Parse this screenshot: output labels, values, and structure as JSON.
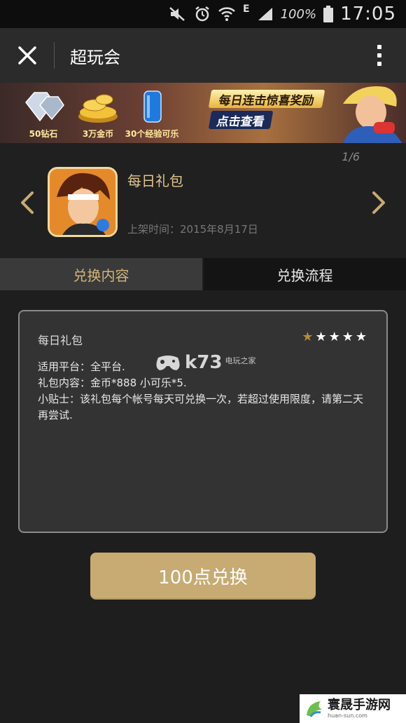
{
  "status_bar": {
    "network_type": "E",
    "battery_percent": "100%",
    "time": "17:05"
  },
  "titlebar": {
    "title": "超玩会"
  },
  "banner": {
    "prizes": [
      {
        "label": "50钻石",
        "icon": "diamond-icon"
      },
      {
        "label": "3万金币",
        "icon": "gold-coin-icon"
      },
      {
        "label": "30个经验可乐",
        "icon": "cola-can-icon"
      }
    ],
    "headline": "每日连击惊喜奖励",
    "cta": "点击查看"
  },
  "game_card": {
    "pager": "1/6",
    "name": "每日礼包",
    "release_label": "上架时间：2015年8月17日"
  },
  "tabs": [
    {
      "label": "兑换内容",
      "active": true
    },
    {
      "label": "兑换流程",
      "active": false
    }
  ],
  "content": {
    "title": "每日礼包",
    "rating": {
      "filled": 1,
      "total": 5
    },
    "lines": [
      "适用平台：全平台.",
      "礼包内容：金币*888 小可乐*5.",
      "小贴士：该礼包每个帐号每天可兑换一次，若超过使用限度，请第二天再尝试."
    ],
    "watermark": {
      "brand": "k73",
      "sub": "电玩之家"
    }
  },
  "redeem_button": {
    "label": "100点兑换"
  },
  "site_badge": {
    "name": "寰晟手游网",
    "url": "huan-sun.com"
  },
  "colors": {
    "accent_gold": "#c8ab72",
    "tab_active_text": "#d3b37a",
    "background": "#1e1e1e"
  }
}
